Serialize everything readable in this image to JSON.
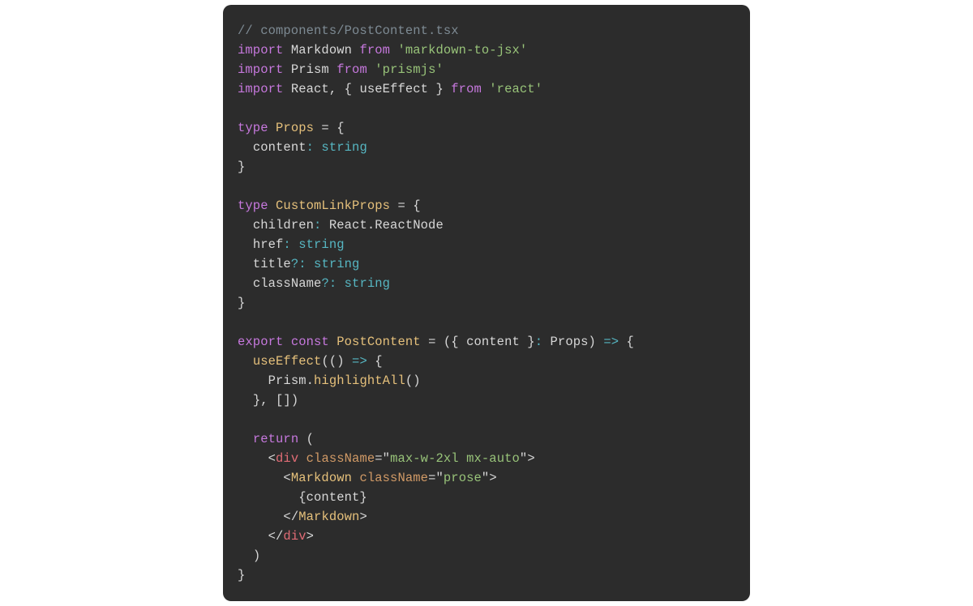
{
  "colors": {
    "bg_page": "#ffffff",
    "bg_code": "#2c2c2c",
    "fg_default": "#d7d7d7",
    "comment": "#7d8a93",
    "keyword": "#c678dd",
    "string": "#98c379",
    "typename": "#e5c07b",
    "primitive": "#56b6c2",
    "operator": "#56b6c2",
    "tag_red": "#e06c75",
    "tag_yellow": "#e5c07b",
    "attr": "#d19a66"
  },
  "code": {
    "l1_comment": "// components/PostContent.tsx",
    "l2": {
      "kw_import": "import",
      "name": "Markdown",
      "kw_from": "from",
      "str": "'markdown-to-jsx'"
    },
    "l3": {
      "kw_import": "import",
      "name": "Prism",
      "kw_from": "from",
      "str": "'prismjs'"
    },
    "l4": {
      "kw_import": "import",
      "names": "React, { useEffect }",
      "kw_from": "from",
      "str": "'react'"
    },
    "l6": {
      "kw_type": "type",
      "tname": "Props",
      "eq": " = {"
    },
    "l7": {
      "indent": "  ",
      "field": "content",
      "colon": ":",
      "ftype": " string"
    },
    "l8": {
      "close": "}"
    },
    "l10": {
      "kw_type": "type",
      "tname": "CustomLinkProps",
      "eq": " = {"
    },
    "l11": {
      "indent": "  ",
      "field": "children",
      "colon": ":",
      "ftype": " React.ReactNode"
    },
    "l12": {
      "indent": "  ",
      "field": "href",
      "colon": ":",
      "ftype": " string"
    },
    "l13": {
      "indent": "  ",
      "field": "title",
      "opt": "?:",
      "ftype": " string"
    },
    "l14": {
      "indent": "  ",
      "field": "className",
      "opt": "?:",
      "ftype": " string"
    },
    "l15": {
      "close": "}"
    },
    "l17": {
      "kw_export": "export",
      "kw_const": "const",
      "fn": "PostContent",
      "rest1": " = ({ content }",
      "colon": ":",
      "rest2": " Props) ",
      "arrow": "=>",
      "brace": " {"
    },
    "l18": {
      "indent": "  ",
      "fn": "useEffect",
      "rest": "(() ",
      "arrow": "=>",
      "brace": " {"
    },
    "l19": {
      "indent": "    ",
      "obj": "Prism.",
      "method": "highlightAll",
      "rest": "()"
    },
    "l20": {
      "indent": "  ",
      "rest": "}, [])"
    },
    "l22": {
      "indent": "  ",
      "kw_return": "return",
      "rest": " ("
    },
    "l23": {
      "indent": "    ",
      "lt": "<",
      "tag": "div",
      "sp": " ",
      "attr": "className",
      "eq": "=",
      "q1": "\"",
      "val": "max-w-2xl mx-auto",
      "q2": "\"",
      "gt": ">"
    },
    "l24": {
      "indent": "      ",
      "lt": "<",
      "tag": "Markdown",
      "sp": " ",
      "attr": "className",
      "eq": "=",
      "q1": "\"",
      "val": "prose",
      "q2": "\"",
      "gt": ">"
    },
    "l25": {
      "indent": "        ",
      "expr": "{content}"
    },
    "l26": {
      "indent": "      ",
      "lt": "</",
      "tag": "Markdown",
      "gt": ">"
    },
    "l27": {
      "indent": "    ",
      "lt": "</",
      "tag": "div",
      "gt": ">"
    },
    "l28": {
      "indent": "  ",
      "rest": ")"
    },
    "l29": {
      "rest": "}"
    }
  }
}
